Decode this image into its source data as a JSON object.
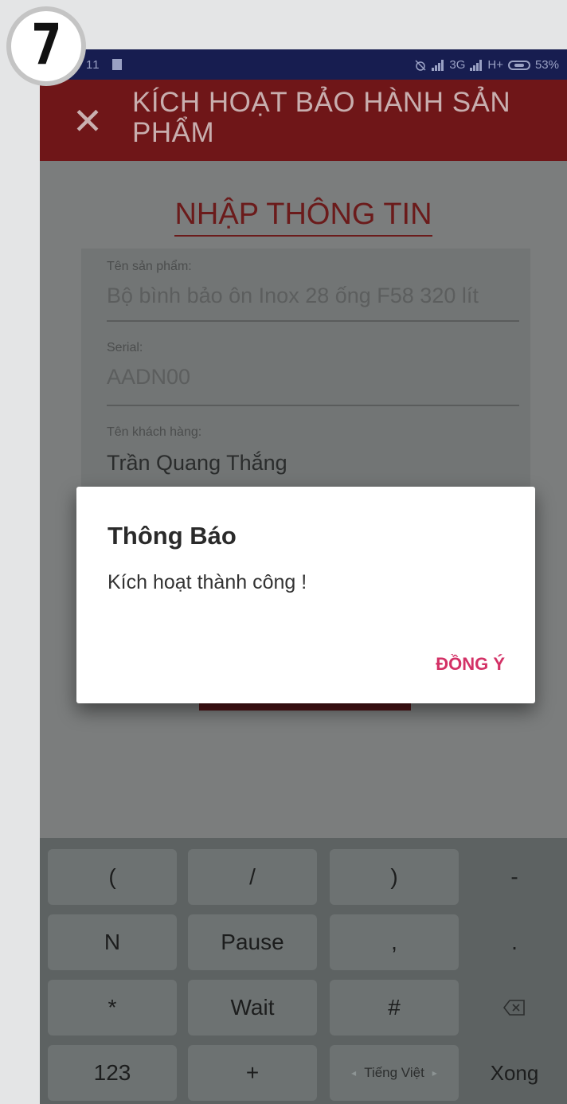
{
  "step": {
    "number": "7"
  },
  "status_bar": {
    "left_text": "11",
    "network": "3G",
    "network2": "H+",
    "battery": "53%"
  },
  "app_bar": {
    "title": "KÍCH HOẠT BẢO HÀNH SẢN PHẨM",
    "close_icon": "close-icon"
  },
  "form": {
    "heading": "NHẬP THÔNG TIN",
    "fields": [
      {
        "label": "Tên sản phẩm:",
        "value": "Bộ bình bảo ôn Inox 28 ống F58 320 lít"
      },
      {
        "label": "Serial:",
        "value": "AADN00"
      },
      {
        "label": "Tên khách hàng:",
        "value": "Trần Quang Thắng"
      }
    ]
  },
  "dialog": {
    "title": "Thông Báo",
    "message": "Kích hoạt thành công !",
    "ok_label": "ĐỒNG Ý"
  },
  "keyboard": {
    "rows": [
      [
        "(",
        "/",
        ")",
        "-"
      ],
      [
        "N",
        "Pause",
        ",",
        "."
      ],
      [
        "*",
        "Wait",
        "#",
        "backspace-icon"
      ],
      [
        "123",
        "+",
        "Tiếng Việt",
        "Xong"
      ]
    ]
  },
  "colors": {
    "app_bar": "#6f1618",
    "status_bar": "#171d50",
    "accent": "#d33166"
  }
}
